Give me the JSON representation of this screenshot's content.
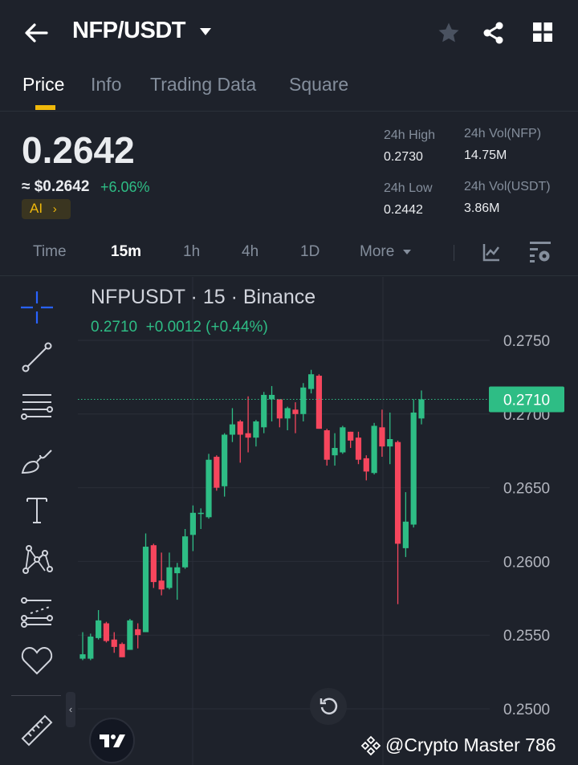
{
  "header": {
    "title": "NFP/USDT"
  },
  "tabs": [
    "Price",
    "Info",
    "Trading Data",
    "Square"
  ],
  "price": {
    "last": "0.2642",
    "usd": "≈ $0.2642",
    "change": "+6.06%",
    "ai_label": "AI",
    "high_label": "24h High",
    "high": "0.2730",
    "low_label": "24h Low",
    "low": "0.2442",
    "vol_base_label": "24h Vol(NFP)",
    "vol_base": "14.75M",
    "vol_quote_label": "24h Vol(USDT)",
    "vol_quote": "3.86M"
  },
  "timeframes": [
    "Time",
    "15m",
    "1h",
    "4h",
    "1D",
    "More"
  ],
  "chart_header": {
    "title": "NFPUSDT · 15 · Binance",
    "ohlc": "0.2710  +0.0012 (+0.44%)"
  },
  "watermark": "@Crypto Master 786",
  "colors": {
    "up": "#2ebd85",
    "down": "#f6465d",
    "accent": "#f0b90b",
    "bg": "#1e222b"
  },
  "chart_data": {
    "type": "candlestick",
    "title": "NFPUSDT · 15 · Binance",
    "ylim": [
      0.25,
      0.275
    ],
    "y_ticks": [
      "0.2750",
      "0.2700",
      "0.2650",
      "0.2600",
      "0.2550",
      "0.2500"
    ],
    "current_price": "0.2710",
    "candles_ohlc": [
      [
        0.2534,
        0.2552,
        0.2533,
        0.2537
      ],
      [
        0.2534,
        0.2551,
        0.2533,
        0.2549
      ],
      [
        0.2548,
        0.2567,
        0.2547,
        0.256
      ],
      [
        0.2558,
        0.2559,
        0.2545,
        0.2546
      ],
      [
        0.2547,
        0.2552,
        0.2538,
        0.2542
      ],
      [
        0.2544,
        0.2545,
        0.2535,
        0.2535
      ],
      [
        0.254,
        0.2561,
        0.254,
        0.256
      ],
      [
        0.2554,
        0.2558,
        0.2541,
        0.255
      ],
      [
        0.2552,
        0.2619,
        0.2552,
        0.261
      ],
      [
        0.2611,
        0.2612,
        0.2582,
        0.2586
      ],
      [
        0.2587,
        0.2606,
        0.2577,
        0.2581
      ],
      [
        0.2582,
        0.2606,
        0.2581,
        0.2596
      ],
      [
        0.2592,
        0.2599,
        0.2574,
        0.2596
      ],
      [
        0.2596,
        0.2622,
        0.2595,
        0.2617
      ],
      [
        0.2618,
        0.2638,
        0.2607,
        0.2633
      ],
      [
        0.2633,
        0.2636,
        0.2622,
        0.2633
      ],
      [
        0.263,
        0.2673,
        0.2629,
        0.2669
      ],
      [
        0.2671,
        0.2672,
        0.2648,
        0.265
      ],
      [
        0.2651,
        0.2687,
        0.2644,
        0.2686
      ],
      [
        0.2686,
        0.2704,
        0.2681,
        0.2693
      ],
      [
        0.2695,
        0.2696,
        0.2667,
        0.2686
      ],
      [
        0.2687,
        0.2712,
        0.2674,
        0.2684
      ],
      [
        0.2684,
        0.2696,
        0.2678,
        0.2695
      ],
      [
        0.2691,
        0.2715,
        0.2687,
        0.2713
      ],
      [
        0.271,
        0.2719,
        0.2695,
        0.2713
      ],
      [
        0.271,
        0.271,
        0.2691,
        0.2697
      ],
      [
        0.2697,
        0.2705,
        0.2689,
        0.2704
      ],
      [
        0.2703,
        0.2708,
        0.2687,
        0.27
      ],
      [
        0.27,
        0.2721,
        0.2695,
        0.2718
      ],
      [
        0.2717,
        0.273,
        0.2714,
        0.2727
      ],
      [
        0.2726,
        0.2727,
        0.269,
        0.269
      ],
      [
        0.2689,
        0.269,
        0.2665,
        0.2669
      ],
      [
        0.2672,
        0.2687,
        0.2665,
        0.2677
      ],
      [
        0.2674,
        0.2692,
        0.2673,
        0.2691
      ],
      [
        0.2688,
        0.2688,
        0.2677,
        0.2682
      ],
      [
        0.2684,
        0.2688,
        0.2666,
        0.2669
      ],
      [
        0.267,
        0.2672,
        0.2655,
        0.2661
      ],
      [
        0.266,
        0.2694,
        0.2659,
        0.2692
      ],
      [
        0.2691,
        0.2703,
        0.2671,
        0.2678
      ],
      [
        0.2678,
        0.2701,
        0.2666,
        0.2683
      ],
      [
        0.2681,
        0.2682,
        0.2571,
        0.2612
      ],
      [
        0.2609,
        0.2647,
        0.2603,
        0.2627
      ],
      [
        0.2625,
        0.271,
        0.2623,
        0.2701
      ],
      [
        0.2697,
        0.2716,
        0.2693,
        0.271
      ]
    ]
  }
}
